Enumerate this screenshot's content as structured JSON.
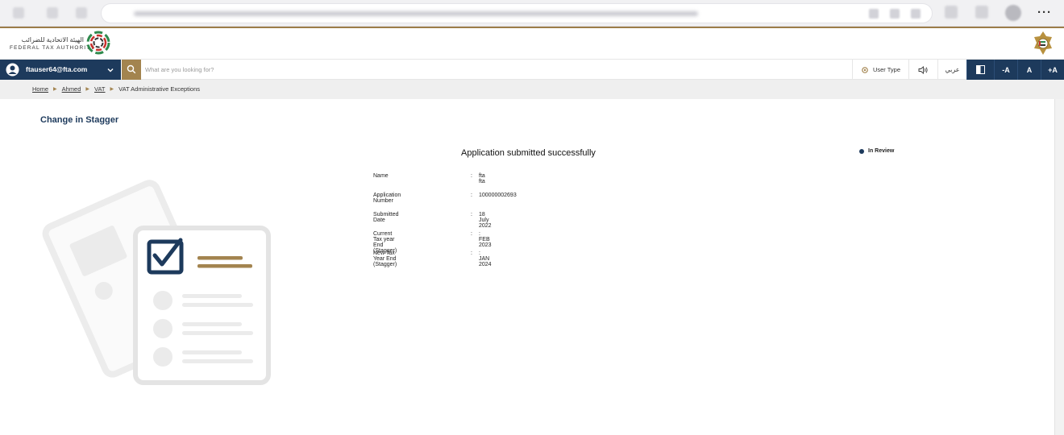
{
  "header": {
    "org_name_ar": "الهيئة الاتحادية للضرائب",
    "org_name_en": "FEDERAL TAX AUTHORITY"
  },
  "navbar": {
    "user_email": "ftauser64@fta.com",
    "search_placeholder": "What are you looking for?",
    "user_type_label": "User Type",
    "language_label": "عربي",
    "font_decrease": "-A",
    "font_reset": "A",
    "font_increase": "+A"
  },
  "breadcrumb": {
    "items": [
      "Home",
      "Ahmed",
      "VAT",
      "VAT Administrative Exceptions"
    ]
  },
  "page": {
    "title": "Change in Stagger",
    "success_message": "Application submitted successfully",
    "status": "In Review",
    "details": [
      {
        "label": "Name",
        "colon": ":",
        "value": "fta fta"
      },
      {
        "label": "Application Number",
        "colon": ":",
        "value": "100000002693"
      },
      {
        "label": "Submitted Date",
        "colon": ":",
        "value": "18 July 2022"
      },
      {
        "label": "Current Tax year End (Stagger)",
        "colon": ":",
        "value": ": FEB 2023"
      },
      {
        "label": "New Tax Year End (Stagger)",
        "colon": ":",
        "value": ": JAN 2024"
      }
    ]
  },
  "browser": {
    "more_menu": "···"
  },
  "colors": {
    "navy": "#1d3a5c",
    "gold": "#a3844f",
    "breadcrumb_bg": "#efefef"
  }
}
